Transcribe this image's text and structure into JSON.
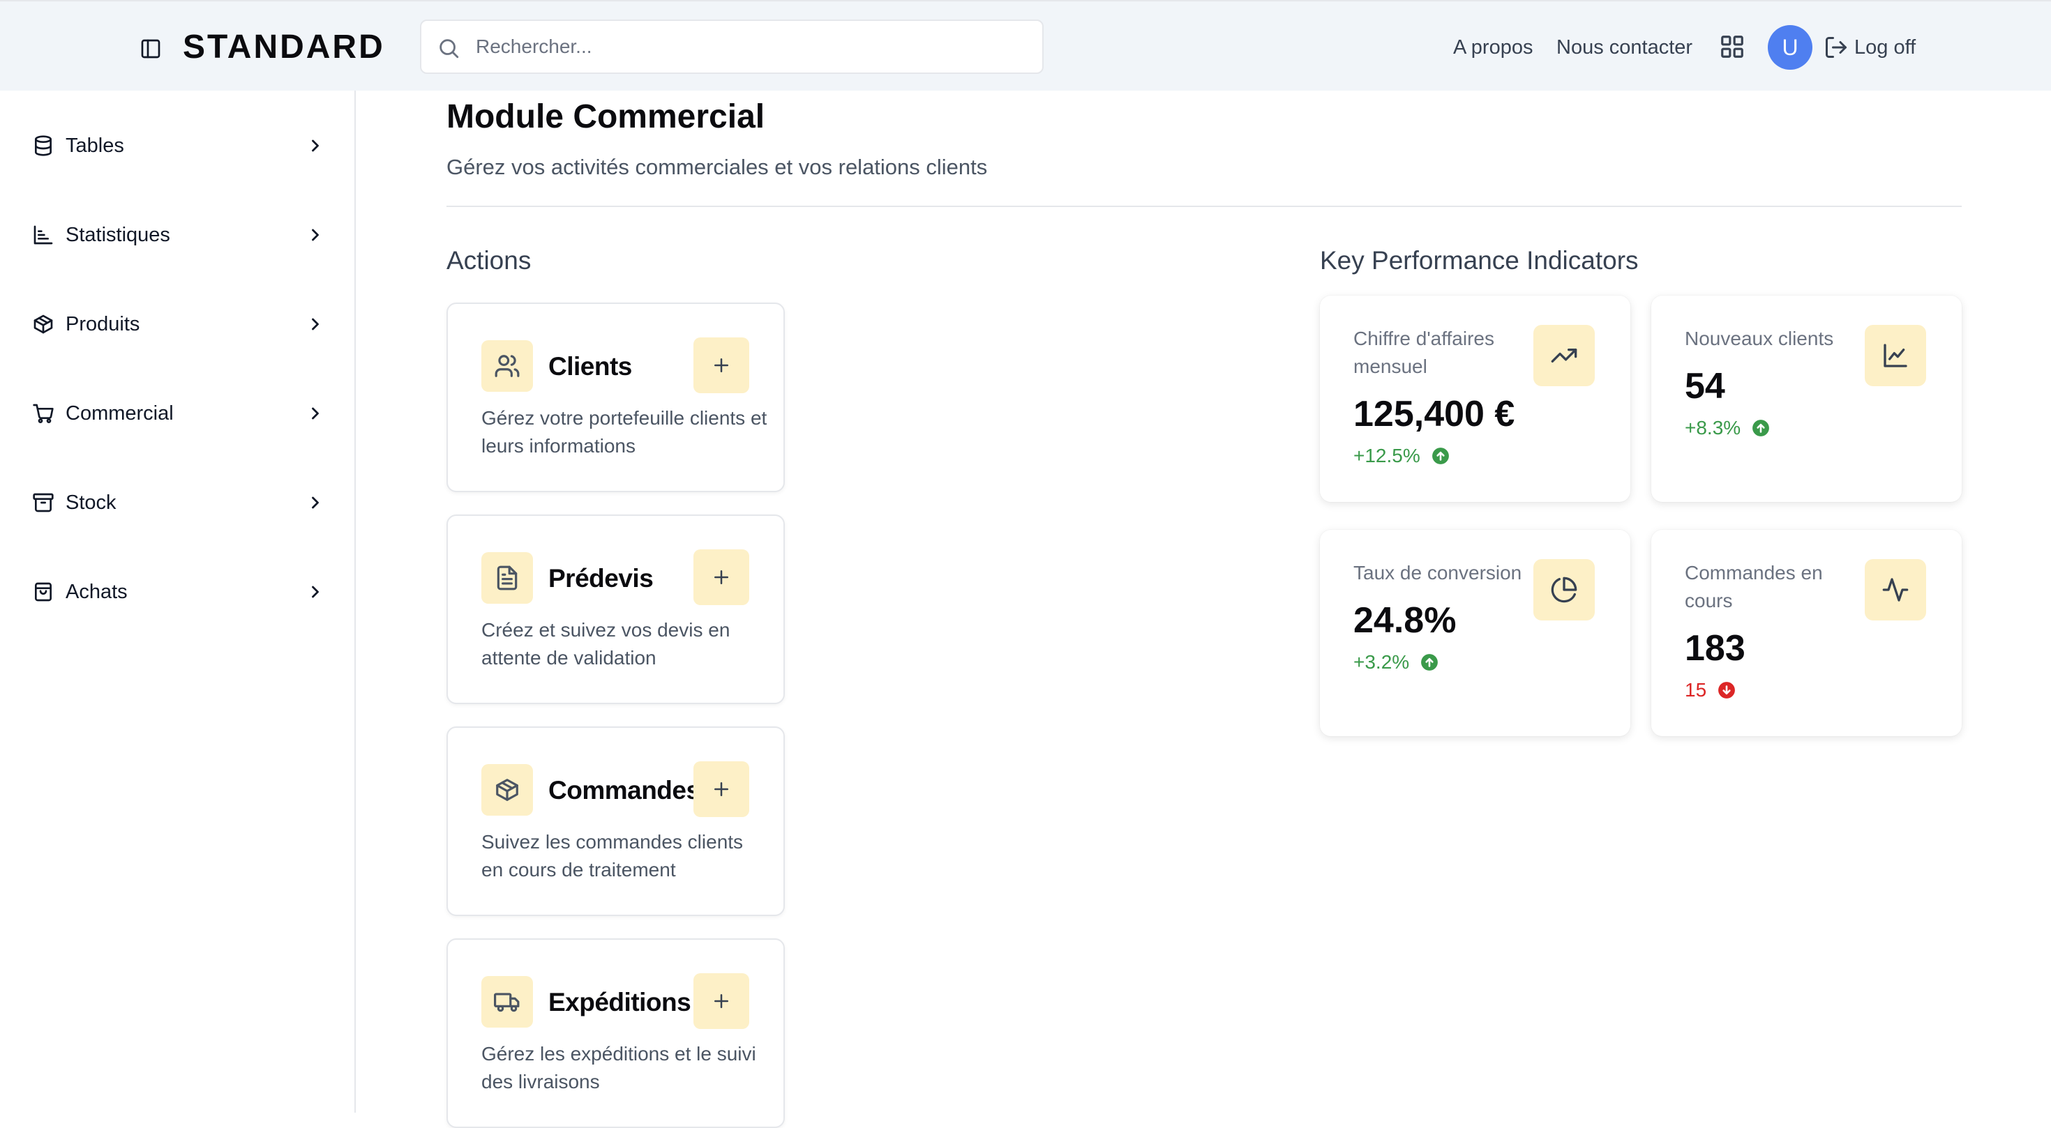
{
  "header": {
    "brand": "STANDARD",
    "search_placeholder": "Rechercher...",
    "links": [
      "A propos",
      "Nous contacter"
    ],
    "avatar_initial": "U",
    "logoff_label": "Log off"
  },
  "sidebar": {
    "items": [
      {
        "label": "Tables",
        "icon": "database-icon"
      },
      {
        "label": "Statistiques",
        "icon": "bar-chart-icon"
      },
      {
        "label": "Produits",
        "icon": "package-icon"
      },
      {
        "label": "Commercial",
        "icon": "shopping-cart-icon"
      },
      {
        "label": "Stock",
        "icon": "archive-icon"
      },
      {
        "label": "Achats",
        "icon": "shopping-bag-icon"
      }
    ]
  },
  "main": {
    "title": "Module Commercial",
    "subtitle": "Gérez vos activités commerciales et vos relations clients",
    "actions_title": "Actions",
    "kpi_title": "Key Performance Indicators"
  },
  "actions": [
    {
      "title": "Clients",
      "icon": "users-icon",
      "description": "Gérez votre portefeuille clients et leurs informations"
    },
    {
      "title": "Prédevis",
      "icon": "file-text-icon",
      "description": "Créez et suivez vos devis en attente de validation"
    },
    {
      "title": "Commandes",
      "icon": "package-icon",
      "description": "Suivez les commandes clients en cours de traitement"
    },
    {
      "title": "Expéditions",
      "icon": "truck-icon",
      "description": "Gérez les expéditions et le suivi des livraisons"
    }
  ],
  "kpis": [
    {
      "label": "Chiffre d'affaires mensuel",
      "value": "125,400 €",
      "change": "+12.5%",
      "trend": "up",
      "icon": "trending-up-icon"
    },
    {
      "label": "Nouveaux clients",
      "value": "54",
      "change": "+8.3%",
      "trend": "up",
      "icon": "line-chart-icon"
    },
    {
      "label": "Taux de conversion",
      "value": "24.8%",
      "change": "+3.2%",
      "trend": "up",
      "icon": "pie-chart-icon"
    },
    {
      "label": "Commandes en cours",
      "value": "183",
      "change": "15",
      "trend": "down",
      "icon": "activity-icon"
    }
  ],
  "colors": {
    "header_bg": "#f1f5f9",
    "accent_bg": "#fdf0c7",
    "avatar": "#4f7ff0",
    "positive": "#3a9a4a",
    "negative": "#dc2626"
  }
}
